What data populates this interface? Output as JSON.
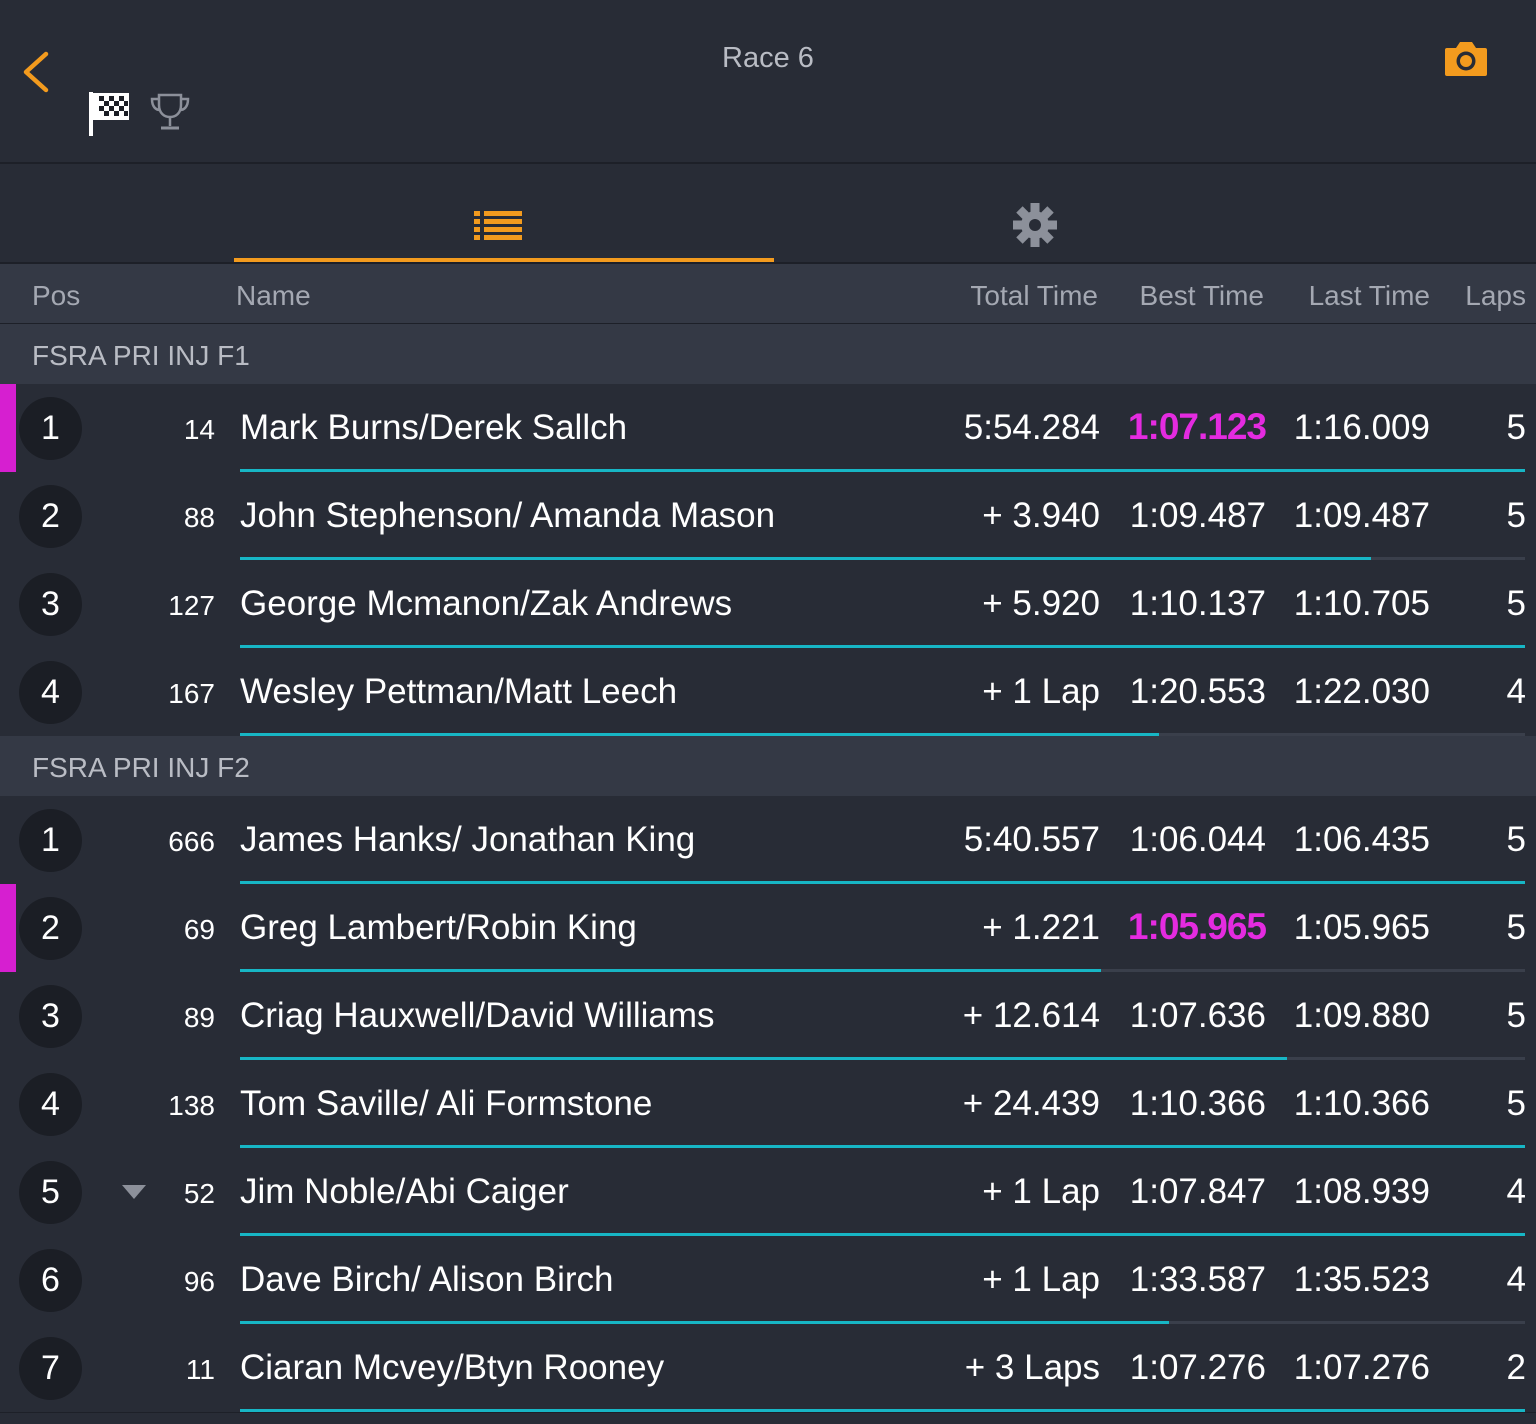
{
  "header": {
    "title": "Race 6"
  },
  "icons": {
    "back": "chevron-left-icon",
    "flag": "checkered-flag-icon",
    "trophy": "trophy-icon",
    "camera": "camera-icon",
    "list": "list-icon",
    "settings": "gear-icon"
  },
  "colors": {
    "accent": "#f39b1e",
    "fastest": "#e42be0",
    "progress": "#17b6c5",
    "background": "#282c36"
  },
  "columns": {
    "pos": "Pos",
    "name": "Name",
    "total": "Total Time",
    "best": "Best Time",
    "last": "Last Time",
    "laps": "Laps"
  },
  "groups": [
    {
      "label": "FSRA PRI INJ F1",
      "rows": [
        {
          "pos": "1",
          "num": "14",
          "name": "Mark Burns/Derek Sallch",
          "total": "5:54.284",
          "best": "1:07.123",
          "last": "1:16.009",
          "laps": "5",
          "fastest": true,
          "trend": "",
          "progress": 1.0
        },
        {
          "pos": "2",
          "num": "88",
          "name": "John Stephenson/ Amanda Mason",
          "total": "+ 3.940",
          "best": "1:09.487",
          "last": "1:09.487",
          "laps": "5",
          "fastest": false,
          "trend": "",
          "progress": 0.88
        },
        {
          "pos": "3",
          "num": "127",
          "name": "George Mcmanon/Zak Andrews",
          "total": "+ 5.920",
          "best": "1:10.137",
          "last": "1:10.705",
          "laps": "5",
          "fastest": false,
          "trend": "",
          "progress": 1.0
        },
        {
          "pos": "4",
          "num": "167",
          "name": "Wesley Pettman/Matt Leech",
          "total": "+ 1 Lap",
          "best": "1:20.553",
          "last": "1:22.030",
          "laps": "4",
          "fastest": false,
          "trend": "",
          "progress": 0.715
        }
      ]
    },
    {
      "label": "FSRA PRI INJ F2",
      "rows": [
        {
          "pos": "1",
          "num": "666",
          "name": "James Hanks/ Jonathan King",
          "total": "5:40.557",
          "best": "1:06.044",
          "last": "1:06.435",
          "laps": "5",
          "fastest": false,
          "trend": "",
          "progress": 1.0
        },
        {
          "pos": "2",
          "num": "69",
          "name": "Greg Lambert/Robin King",
          "total": "+ 1.221",
          "best": "1:05.965",
          "last": "1:05.965",
          "laps": "5",
          "fastest": true,
          "trend": "",
          "progress": 0.67
        },
        {
          "pos": "3",
          "num": "89",
          "name": "Criag Hauxwell/David Williams",
          "total": "+ 12.614",
          "best": "1:07.636",
          "last": "1:09.880",
          "laps": "5",
          "fastest": false,
          "trend": "",
          "progress": 0.815
        },
        {
          "pos": "4",
          "num": "138",
          "name": "Tom Saville/ Ali Formstone",
          "total": "+ 24.439",
          "best": "1:10.366",
          "last": "1:10.366",
          "laps": "5",
          "fastest": false,
          "trend": "",
          "progress": 1.0
        },
        {
          "pos": "5",
          "num": "52",
          "name": "Jim Noble/Abi Caiger",
          "total": "+ 1 Lap",
          "best": "1:07.847",
          "last": "1:08.939",
          "laps": "4",
          "fastest": false,
          "trend": "down",
          "progress": 1.0
        },
        {
          "pos": "6",
          "num": "96",
          "name": "Dave Birch/ Alison Birch",
          "total": "+ 1 Lap",
          "best": "1:33.587",
          "last": "1:35.523",
          "laps": "4",
          "fastest": false,
          "trend": "",
          "progress": 0.723
        },
        {
          "pos": "7",
          "num": "11",
          "name": "Ciaran Mcvey/Btyn Rooney",
          "total": "+ 3 Laps",
          "best": "1:07.276",
          "last": "1:07.276",
          "laps": "2",
          "fastest": false,
          "trend": "",
          "progress": 1.0
        }
      ]
    }
  ]
}
